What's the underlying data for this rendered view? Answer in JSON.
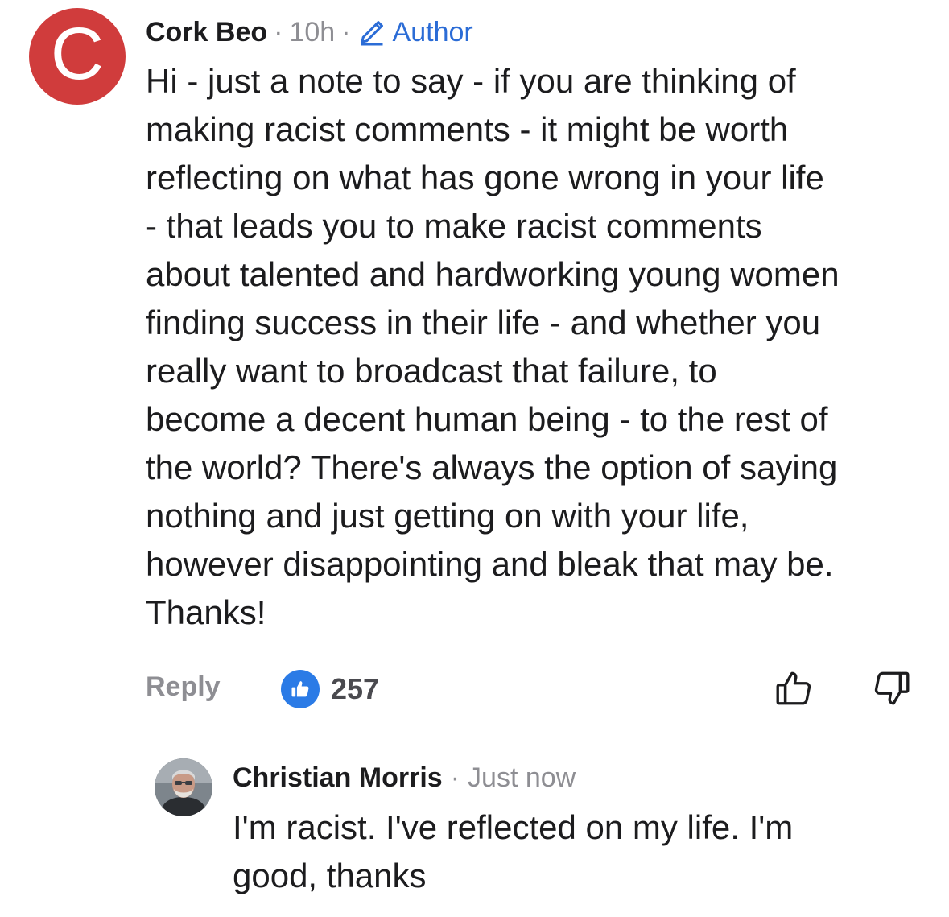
{
  "comment": {
    "avatar_letter": "C",
    "avatar_color": "#d03c3c",
    "author_name": "Cork Beo",
    "separator": "·",
    "timestamp": "10h",
    "author_badge": "Author",
    "author_badge_icon": "pencil-icon",
    "body_lines": [
      "Hi - just a note to say - if you are thinking of",
      "making racist comments - it might be worth",
      "reflecting on what has gone wrong in your life",
      "- that leads you to make racist comments",
      "about talented and hardworking young women",
      "finding success in their life - and whether you",
      "really want to broadcast that failure, to",
      "become a decent human being - to the rest of",
      "the world? There's always the option of saying",
      "nothing and just getting on with your life,",
      "however disappointing and bleak that may be.",
      "Thanks!"
    ],
    "actions": {
      "reply_label": "Reply",
      "like_count": "257",
      "like_badge_color": "#2b7be6",
      "like_icon": "thumbs-up-icon",
      "dislike_icon": "thumbs-down-icon"
    }
  },
  "reply": {
    "author_name": "Christian Morris",
    "separator": "·",
    "timestamp": "Just now",
    "body_lines": [
      "I'm racist. I've reflected on my life. I'm",
      "good, thanks"
    ]
  },
  "colors": {
    "text_primary": "#1c1c1e",
    "text_secondary": "#8e8e93",
    "accent_blue": "#2b6cd6"
  }
}
